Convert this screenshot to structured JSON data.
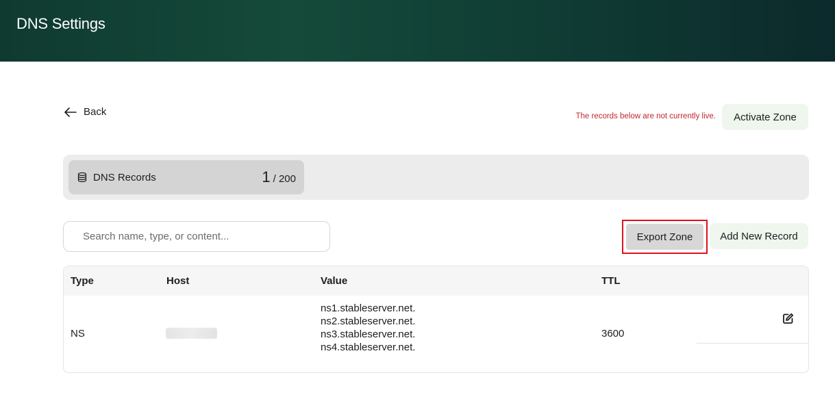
{
  "header": {
    "title": "DNS Settings"
  },
  "nav": {
    "back_label": "Back"
  },
  "zone_status": {
    "notice": "The records below are not currently live.",
    "activate_label": "Activate Zone"
  },
  "records_summary": {
    "label": "DNS Records",
    "count": "1",
    "total": "/ 200"
  },
  "search": {
    "placeholder": "Search name, type, or content..."
  },
  "actions": {
    "export_label": "Export Zone",
    "add_label": "Add New Record"
  },
  "table": {
    "columns": [
      "Type",
      "Host",
      "Value",
      "TTL"
    ],
    "rows": [
      {
        "type": "NS",
        "values": [
          "ns1.stableserver.net.",
          "ns2.stableserver.net.",
          "ns3.stableserver.net.",
          "ns4.stableserver.net."
        ],
        "ttl": "3600"
      }
    ]
  },
  "icons": {
    "back": "arrow-left-icon",
    "records": "database-icon",
    "edit": "edit-icon"
  },
  "colors": {
    "header_start": "#0f3a30",
    "header_end": "#0c2a2b",
    "notice": "#c0262d",
    "highlight_border": "#e0101a",
    "action_bg": "#eef6ee"
  }
}
